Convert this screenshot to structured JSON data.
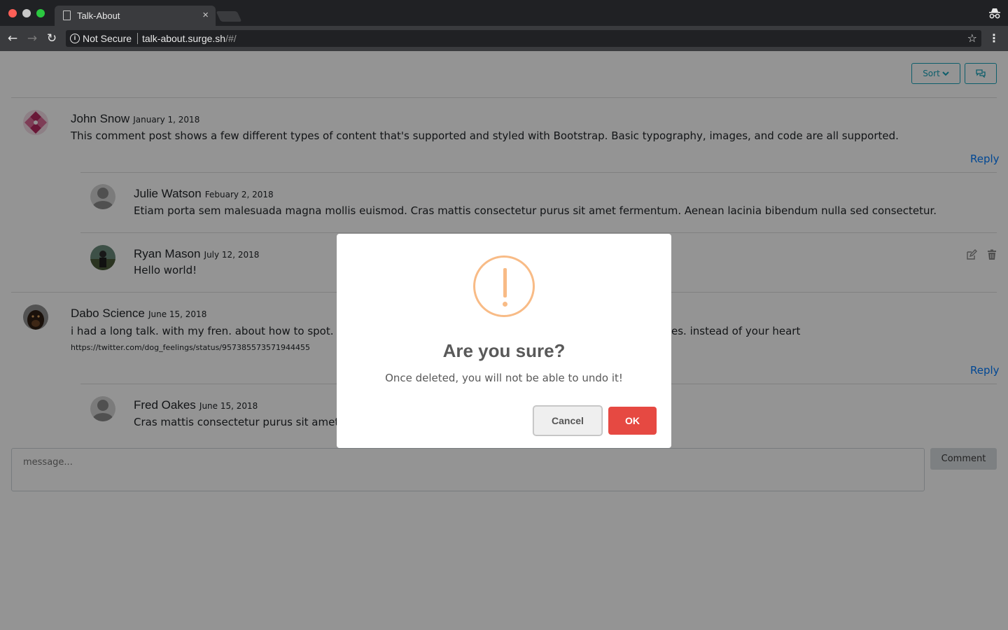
{
  "browser": {
    "tab_title": "Talk-About",
    "tab_close": "×",
    "security_label": "Not Secure",
    "url_host": "talk-about.surge.sh",
    "url_path": "/#/"
  },
  "toolbar": {
    "sort_label": "Sort",
    "sort_icon": "chevron-down-icon",
    "chat_icon": "comments-icon"
  },
  "comments": [
    {
      "name": "John Snow",
      "date": "January 1, 2018",
      "text": "This comment post shows a few different types of content that's supported and styled with Bootstrap. Basic typography, images, and code are all supported.",
      "reply_label": "Reply",
      "avatar": "geometric-avatar",
      "replies": [
        {
          "name": "Julie Watson",
          "date": "Febuary 2, 2018",
          "text": "Etiam porta sem malesuada magna mollis euismod. Cras mattis consectetur purus sit amet fermentum. Aenean lacinia bibendum nulla sed consectetur.",
          "avatar": "default-avatar"
        },
        {
          "name": "Ryan Mason",
          "date": "July 12, 2018",
          "text": "Hello world!",
          "avatar": "photo-avatar",
          "edit_icon": "edit-icon",
          "delete_icon": "trash-icon"
        }
      ]
    },
    {
      "name": "Dabo Science",
      "date": "June 15, 2018",
      "text_start": "i had a long talk. with my fren. about how to spot. a fa",
      "text_end": "es. instead of your heart",
      "link": "https://twitter.com/dog_feelings/status/957385573571944455",
      "reply_label": "Reply",
      "avatar": "dog-avatar",
      "replies": [
        {
          "name": "Fred Oakes",
          "date": "June 15, 2018",
          "text": "Cras mattis consectetur purus sit amet fer",
          "avatar": "default-avatar"
        }
      ]
    }
  ],
  "composer": {
    "placeholder": "message...",
    "submit_label": "Comment"
  },
  "modal": {
    "icon": "warning-icon",
    "title": "Are you sure?",
    "text": "Once deleted, you will not be able to undo it!",
    "cancel_label": "Cancel",
    "ok_label": "OK",
    "ok_color": "#e64942",
    "icon_color": "#f8bb86"
  }
}
